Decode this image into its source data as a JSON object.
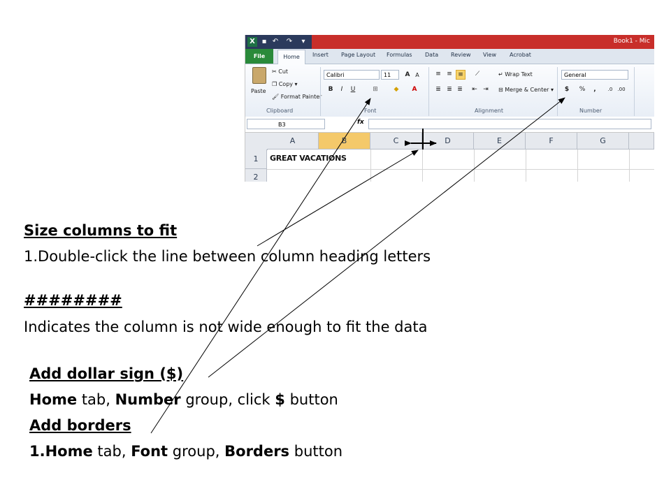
{
  "excel": {
    "title": "Book1 - Mic",
    "tabs": [
      "File",
      "Home",
      "Insert",
      "Page Layout",
      "Formulas",
      "Data",
      "Review",
      "View",
      "Acrobat"
    ],
    "clipboard": {
      "paste": "Paste",
      "cut": "Cut",
      "copy": "Copy",
      "format_painter": "Format Painter",
      "label": "Clipboard"
    },
    "font": {
      "name": "Calibri",
      "size": "11",
      "label": "Font",
      "bold": "B",
      "italic": "I",
      "underline": "U"
    },
    "alignment": {
      "wrap_text": "Wrap Text",
      "merge_center": "Merge & Center",
      "label": "Alignment"
    },
    "number": {
      "format": "General",
      "dollar": "$",
      "percent": "%",
      "comma": ",",
      "label": "Number"
    },
    "name_box": "B3",
    "fx": "fx",
    "columns": [
      "A",
      "B",
      "C",
      "D",
      "E",
      "F",
      "G"
    ],
    "rows": [
      "1",
      "2"
    ],
    "cell_a1": "GREAT VACATIONS"
  },
  "slide": {
    "size_heading": "Size columns to fit",
    "size_step": "1.Double-click the line between column heading letters",
    "hash_heading": "########",
    "hash_desc": "Indicates the column is not wide enough to fit the data",
    "dollar_heading": "Add dollar sign ($)",
    "dollar_bold1": "Home",
    "dollar_t1": " tab, ",
    "dollar_bold2": "Number",
    "dollar_t2": " group, click ",
    "dollar_bold3": "$",
    "dollar_t3": " button",
    "borders_heading": "Add borders",
    "borders_bold1": "1.Home",
    "borders_t1": " tab, ",
    "borders_bold2": "Font",
    "borders_t2": " group, ",
    "borders_bold3": "Borders",
    "borders_t3": " button"
  }
}
